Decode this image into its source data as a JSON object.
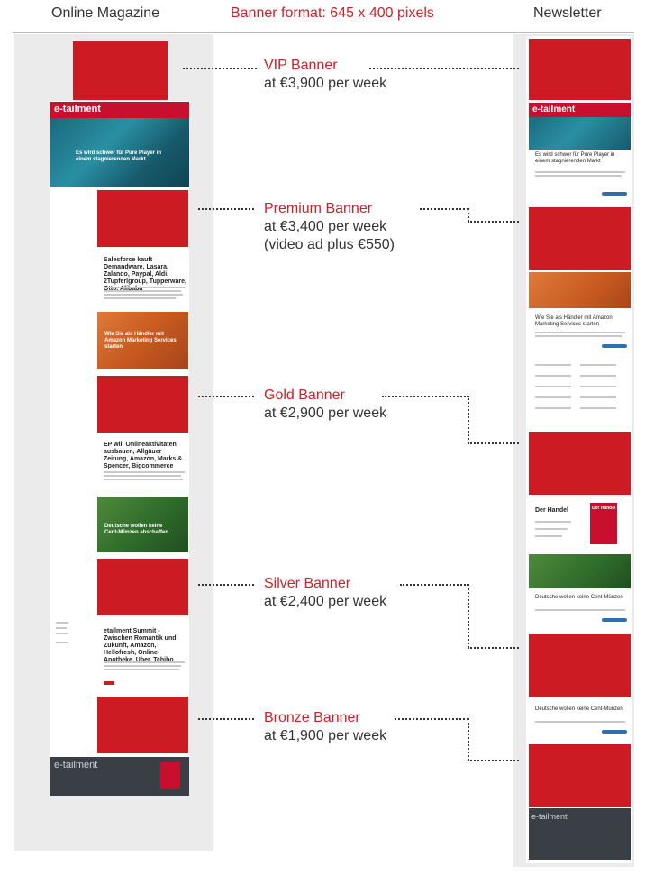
{
  "headers": {
    "online_magazine": "Online Magazine",
    "banner_format": "Banner format: 645 x 400 pixels",
    "newsletter": "Newsletter"
  },
  "colors": {
    "accent": "#cc1b22",
    "text": "#333333",
    "background": "#ebebeb"
  },
  "banners": [
    {
      "name": "VIP Banner",
      "price": "at €3,900 per week"
    },
    {
      "name": "Premium Banner",
      "price": "at €3,400 per week",
      "note": "(video ad plus €550)"
    },
    {
      "name": "Gold Banner",
      "price": "at €2,900 per week"
    },
    {
      "name": "Silver Banner",
      "price": "at €2,400 per week"
    },
    {
      "name": "Bronze Banner",
      "price": "at €1,900 per week"
    }
  ],
  "magazine": {
    "logo": "e-tailment",
    "hero_headline": "Es wird schwer für Pure Player in einem stagnierenden Markt",
    "articles": [
      "Salesforce kauft Demandware, Lasara, Zalando, Paypal, Aldi, 2Tupferlgroup, Tupperware, Otto, Alibaba",
      "Wie Sie als Händler mit Amazon Marketing Services starten",
      "EP will Onlineaktivitäten ausbauen, Allgäuer Zeitung, Amazon, Marks & Spencer, Bigcommerce",
      "Deutsche wollen keine Cent-Münzen abschaffen",
      "etailment Summit - Zwischen Romantik und Zukunft, Amazon, Hellofresh, Online-Apotheke, Uber, Tchibo"
    ]
  },
  "newsletter": {
    "logo": "e-tailment",
    "hero_headline": "Es wird schwer für Pure Player in einem stagnierenden Markt",
    "article_amazon": "Wie Sie als Händler mit Amazon Marketing Services starten",
    "magazine_title": "Der Handel",
    "cover_title": "Der Handel",
    "article_cent": "Deutsche wollen keine Cent-Münzen",
    "article_cent_2": "Deutsche wollen keine Cent-Münzen"
  }
}
